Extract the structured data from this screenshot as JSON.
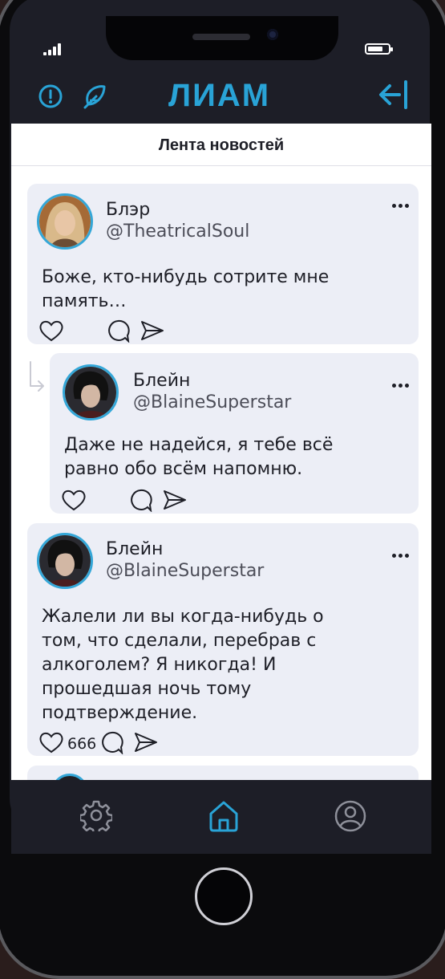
{
  "app": {
    "title": "ЛИАМ",
    "feed_title": "Лента новостей",
    "accent_color": "#29a3d6"
  },
  "status_bar": {
    "signal_icon": "signal-icon",
    "battery_icon": "battery-icon"
  },
  "topbar": {
    "left_icons": [
      "alert-circle-icon",
      "feather-icon"
    ],
    "right_icon": "logout-icon"
  },
  "posts": [
    {
      "author": "Блэр",
      "handle": "@TheatricalSoul",
      "text": "Боже, кто-нибудь сотрите мне память…",
      "likes": "",
      "reply": false
    },
    {
      "author": "Блейн",
      "handle": "@BlaineSuperstar",
      "text": "Даже не надейся, я тебе всё равно обо всём напомню.",
      "likes": "",
      "reply": true
    },
    {
      "author": "Блейн",
      "handle": "@BlaineSuperstar",
      "text": "Жалели ли вы когда-нибудь о том, что сделали, перебрав с алкоголем? Я никогда! И прошедшая ночь тому подтверждение.",
      "likes": "666",
      "reply": false
    }
  ],
  "bottom_nav": {
    "items": [
      "settings-icon",
      "home-icon",
      "profile-icon"
    ],
    "active": "home-icon"
  }
}
